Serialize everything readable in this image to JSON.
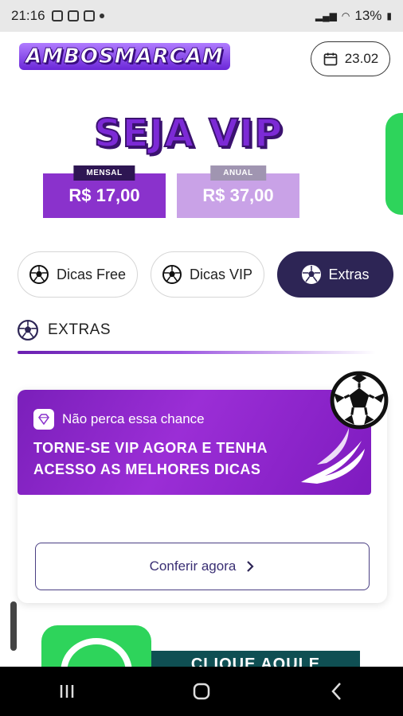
{
  "status_bar": {
    "time": "21:16",
    "battery": "13%"
  },
  "header": {
    "logo_text": "AMBOSMARCAM",
    "date_label": "23.02"
  },
  "vip": {
    "title": "SEJA VIP",
    "plans": [
      {
        "tag": "MENSAL",
        "price": "R$ 17,00"
      },
      {
        "tag": "ANUAL",
        "price": "R$ 37,00"
      }
    ]
  },
  "tabs": [
    {
      "label": "Dicas Free",
      "active": false
    },
    {
      "label": "Dicas VIP",
      "active": false
    },
    {
      "label": "Extras",
      "active": true
    }
  ],
  "section": {
    "title": "EXTRAS"
  },
  "promo": {
    "subtitle": "Não perca essa chance",
    "headline": "TORNE-SE VIP AGORA E TENHA ACESSO AS MELHORES DICAS",
    "cta_label": "Conferir agora"
  },
  "bottom_banner": {
    "text": "CLIQUE AQUI E"
  },
  "colors": {
    "primary_purple": "#8a32cc",
    "dark_navy": "#2d2555",
    "whatsapp_green": "#2ed45b"
  },
  "icons": [
    "calendar-icon",
    "soccer-ball-icon",
    "gem-icon",
    "chevron-right-icon",
    "recent-apps-icon",
    "home-icon",
    "back-icon"
  ]
}
